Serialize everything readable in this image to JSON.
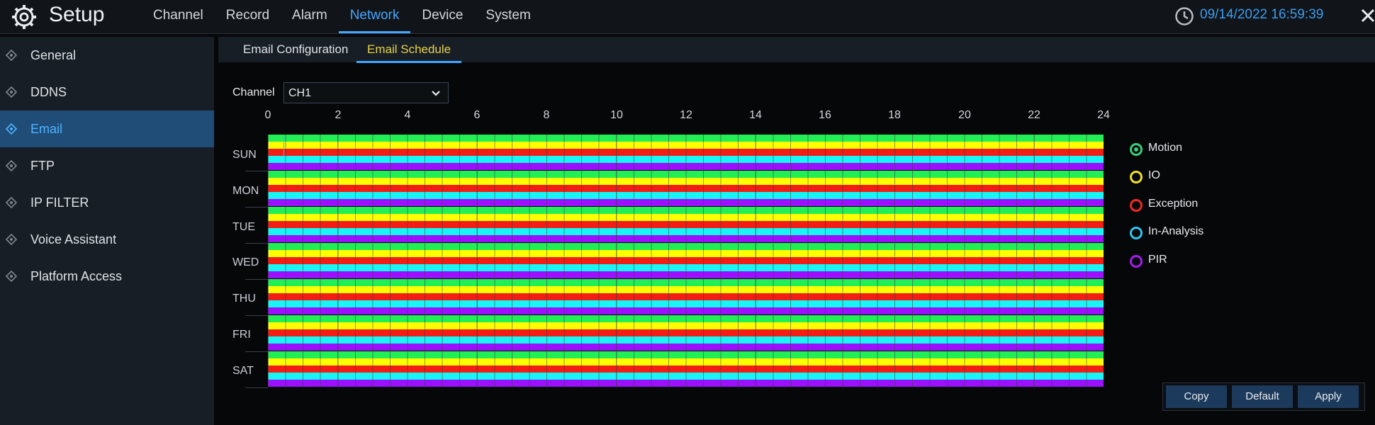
{
  "header": {
    "title": "Setup",
    "nav": [
      "Channel",
      "Record",
      "Alarm",
      "Network",
      "Device",
      "System"
    ],
    "active_nav": "Network",
    "datetime": "09/14/2022 16:59:39"
  },
  "sidebar": {
    "items": [
      "General",
      "DDNS",
      "Email",
      "FTP",
      "IP FILTER",
      "Voice Assistant",
      "Platform Access"
    ],
    "active": "Email"
  },
  "tabs": {
    "items": [
      "Email Configuration",
      "Email Schedule"
    ],
    "active": "Email Schedule"
  },
  "channel": {
    "label": "Channel",
    "value": "CH1"
  },
  "schedule": {
    "hours": [
      "0",
      "2",
      "4",
      "6",
      "8",
      "10",
      "12",
      "14",
      "16",
      "18",
      "20",
      "22",
      "24"
    ],
    "days": [
      "SUN",
      "MON",
      "TUE",
      "WED",
      "THU",
      "FRI",
      "SAT"
    ]
  },
  "legend": [
    {
      "label": "Motion",
      "color": "#3ccf7a",
      "selected": true
    },
    {
      "label": "IO",
      "color": "#f0e12a",
      "selected": false
    },
    {
      "label": "Exception",
      "color": "#f02a24",
      "selected": false
    },
    {
      "label": "In-Analysis",
      "color": "#2ec6f0",
      "selected": false
    },
    {
      "label": "PIR",
      "color": "#a21cf0",
      "selected": false
    }
  ],
  "buttons": {
    "copy": "Copy",
    "default": "Default",
    "apply": "Apply"
  },
  "colors": {
    "accent": "#43a6ff",
    "active_tab_text": "#e6d24a",
    "stripe_green": "#22ee55",
    "stripe_yellow": "#ffff00",
    "stripe_red": "#f21d14",
    "stripe_cyan": "#17f5f5",
    "stripe_purple": "#9b10ff"
  }
}
